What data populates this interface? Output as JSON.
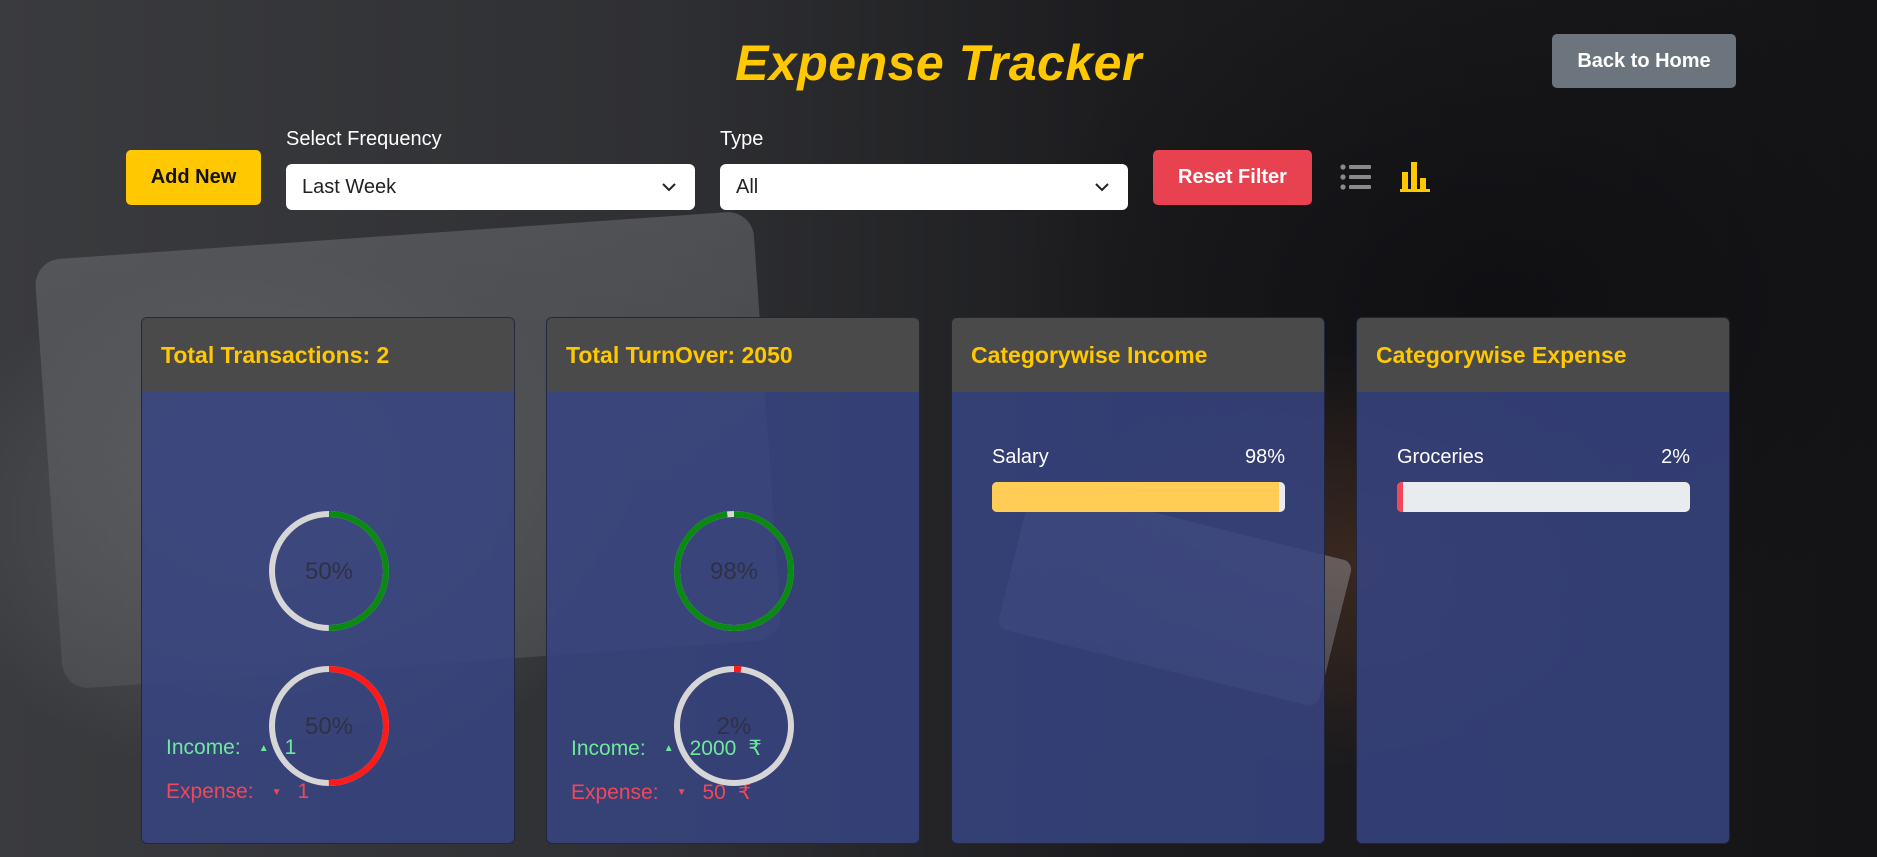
{
  "header": {
    "title": "Expense Tracker",
    "back_label": "Back to Home"
  },
  "toolbar": {
    "add_label": "Add New",
    "frequency_label": "Select Frequency",
    "frequency_value": "Last Week",
    "type_label": "Type",
    "type_value": "All",
    "reset_label": "Reset Filter",
    "list_view_icon": "list-icon",
    "analytics_view_icon": "bar-chart-icon",
    "active_view": "analytics"
  },
  "colors": {
    "accent": "#ffc800",
    "income": "#6de99a",
    "expense": "#f0485a",
    "ring_income": "#0a8a12",
    "ring_expense": "#ff1a1a",
    "ring_track": "#d6d6d6",
    "reset": "#e8414f",
    "back": "#6c757d"
  },
  "panels": {
    "transactions": {
      "title": "Total Transactions: 2",
      "income_label": "Income:",
      "income_value": "1",
      "expense_label": "Expense:",
      "expense_value": "1",
      "income_pct": 50,
      "income_pct_label": "50%",
      "expense_pct": 50,
      "expense_pct_label": "50%"
    },
    "turnover": {
      "title": "Total TurnOver: 2050",
      "income_label": "Income:",
      "income_value": "2000",
      "expense_label": "Expense:",
      "expense_value": "50",
      "currency": "₹",
      "income_pct": 98,
      "income_pct_label": "98%",
      "expense_pct": 2,
      "expense_pct_label": "2%"
    },
    "category_income": {
      "title": "Categorywise Income",
      "items": [
        {
          "name": "Salary",
          "pct_label": "98%",
          "pct": 98,
          "color": "#ffcd56"
        }
      ]
    },
    "category_expense": {
      "title": "Categorywise Expense",
      "items": [
        {
          "name": "Groceries",
          "pct_label": "2%",
          "pct": 2,
          "color": "#f0485a"
        }
      ]
    }
  }
}
